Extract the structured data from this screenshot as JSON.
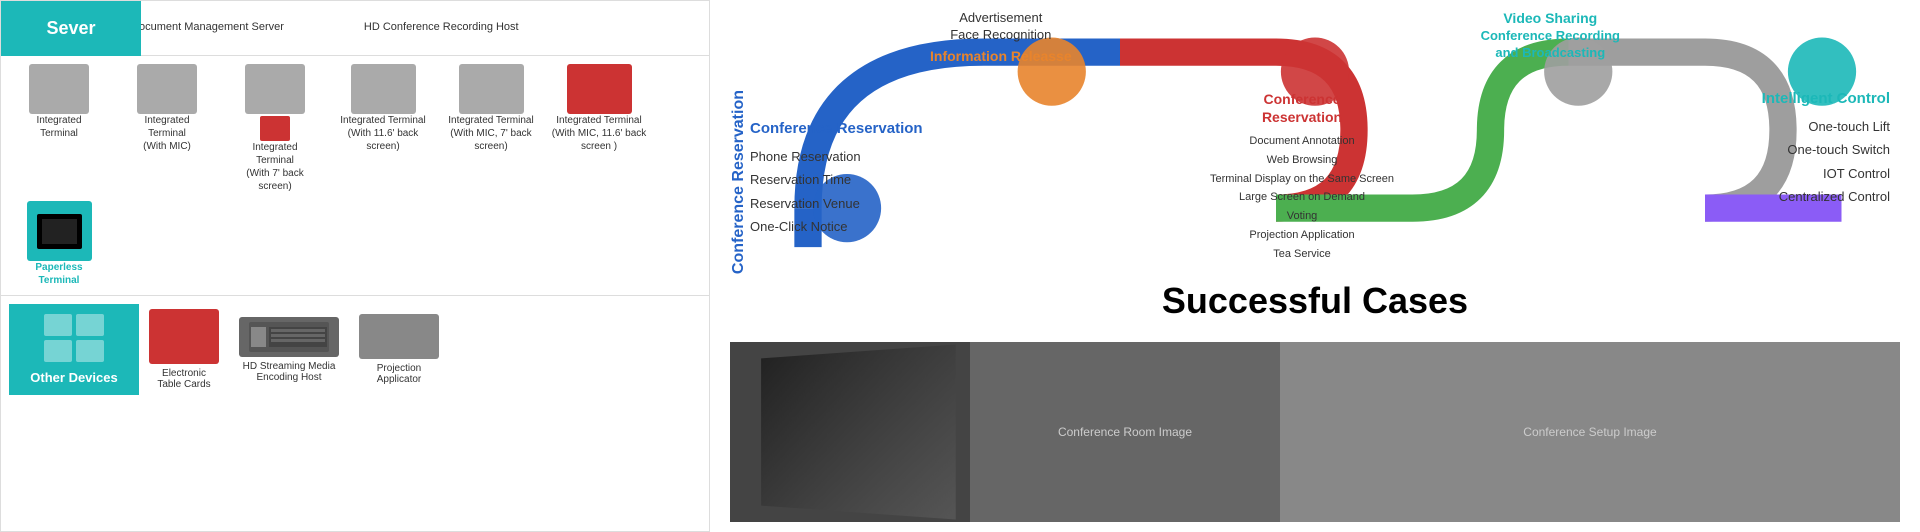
{
  "left_panel": {
    "server_label": "Sever",
    "top_items": [
      {
        "label": "Intelligent Conference\nDocument Management\nServer"
      },
      {
        "label": "HD Conference Recording\nHost"
      }
    ],
    "devices": [
      {
        "label": "Integrated\nTerminal"
      },
      {
        "label": "Integrated\nTerminal\n(With MIC)"
      },
      {
        "label": "Integrated\nTerminal\n(With 7' back\nscreen)"
      },
      {
        "label": "Integrated Terminal\n(With 11.6' back\nscreen)"
      },
      {
        "label": "Integrated Terminal\n(With MIC, 7' back\nscreen)"
      },
      {
        "label": "Integrated Terminal\n(With MIC, 11.6' back\nscreen\n)"
      },
      {
        "label": "Paperless\nTerminal",
        "highlighted": true
      }
    ],
    "other_devices_label": "Other Devices",
    "other_devices": [
      {
        "label": "Electronic\nTable Cards"
      },
      {
        "label": "HD Streaming Media\nEncoding Host"
      },
      {
        "label": "Projection\nApplicator"
      }
    ]
  },
  "diagram": {
    "conference_reservation_label": "Conference Reservation",
    "left_title": "Conference Reservation",
    "left_items": [
      "Phone Reservation",
      "Reservation Time",
      "Reservation Venue",
      "One-Click Notice"
    ],
    "top_items": [
      "Advertisement",
      "Face Recognition"
    ],
    "information_release_label": "Information Releasse",
    "center_label": "Conference\nReservation",
    "center_items": [
      "Document Annotation",
      "Web Browsing",
      "Terminal Display on the Same Screen",
      "Large Screen on Demand",
      "Voting",
      "Projection Application",
      "Tea Service"
    ],
    "top_right_label": "Conference Recording\nand Broadcasting",
    "video_sharing_label": "Video Sharing",
    "top_right_items": [
      "Conference Recording\nand Broadcasting"
    ],
    "right_label": "Intelligent Control",
    "right_items": [
      "One-touch Lift",
      "One-touch Switch",
      "IOT Control",
      "Centralized Control"
    ]
  },
  "successful_cases_title": "Successful Cases",
  "colors": {
    "teal": "#1cb8b8",
    "blue": "#2563c7",
    "orange": "#e8842c",
    "green": "#5cb85c",
    "purple": "#8b5cf6",
    "red": "#cc2222"
  }
}
